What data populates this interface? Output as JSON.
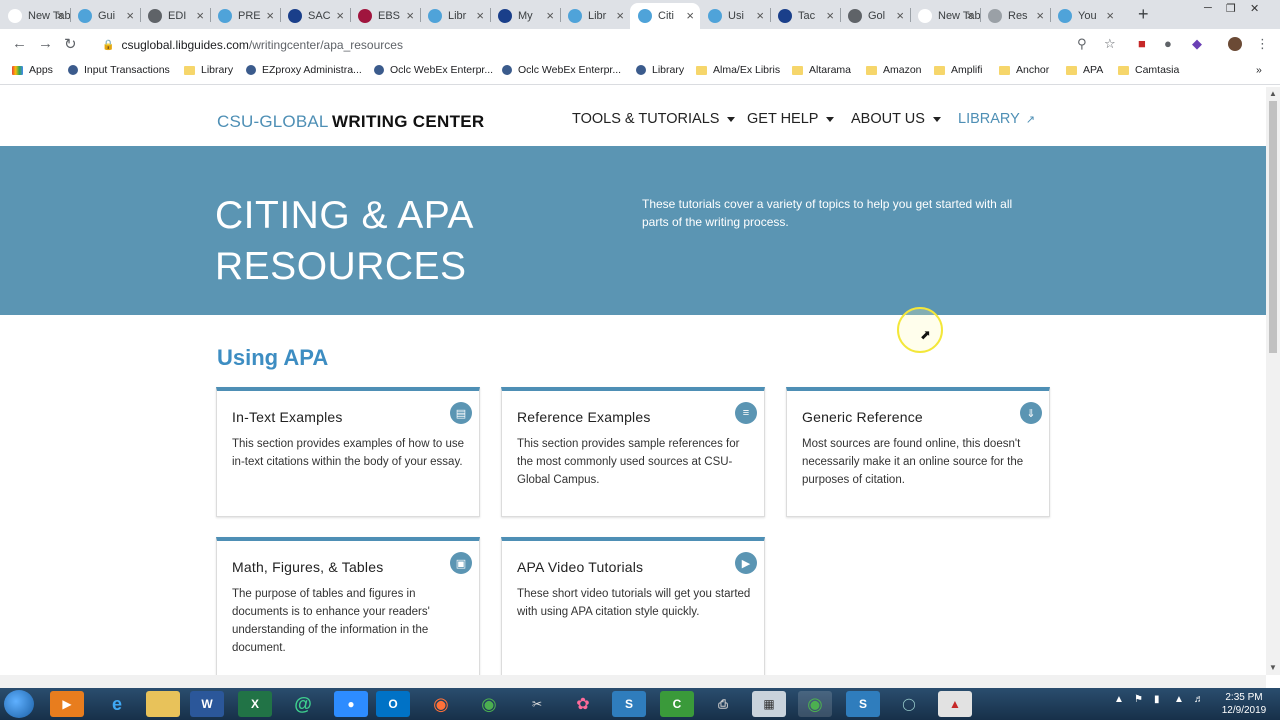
{
  "browser": {
    "tabs": [
      {
        "title": "New Tab",
        "color": "#ffffff"
      },
      {
        "title": "Gui",
        "color": "#4fa3d9"
      },
      {
        "title": "EDI",
        "color": "#5f6368"
      },
      {
        "title": "PRE",
        "color": "#4fa3d9"
      },
      {
        "title": "SAC",
        "color": "#1a3f8a"
      },
      {
        "title": "EBS",
        "color": "#a0153e"
      },
      {
        "title": "Libr",
        "color": "#4fa3d9"
      },
      {
        "title": "My",
        "color": "#1a3f8a"
      },
      {
        "title": "Libr",
        "color": "#4fa3d9"
      },
      {
        "title": "Citi",
        "color": "#4fa3d9"
      },
      {
        "title": "Usi",
        "color": "#4fa3d9"
      },
      {
        "title": "Tac",
        "color": "#1a3f8a"
      },
      {
        "title": "Gol",
        "color": "#5f6368"
      },
      {
        "title": "New Tab",
        "color": "#ffffff"
      },
      {
        "title": "Res",
        "color": "#9aa0a6"
      },
      {
        "title": "You",
        "color": "#4fa3d9"
      }
    ],
    "active_tab_index": 9,
    "url_host": "csuglobal.libguides.com",
    "url_path": "/writingcenter/apa_resources",
    "bookmarks": [
      {
        "label": "Apps",
        "type": "apps"
      },
      {
        "label": "Input Transactions",
        "type": "site"
      },
      {
        "label": "Library",
        "type": "folder"
      },
      {
        "label": "EZproxy Administra...",
        "type": "site"
      },
      {
        "label": "Oclc WebEx Enterpr...",
        "type": "site"
      },
      {
        "label": "Oclc WebEx Enterpr...",
        "type": "site"
      },
      {
        "label": "Library",
        "type": "site"
      },
      {
        "label": "Alma/Ex Libris",
        "type": "folder"
      },
      {
        "label": "Altarama",
        "type": "folder"
      },
      {
        "label": "Amazon",
        "type": "folder"
      },
      {
        "label": "Amplifi",
        "type": "folder"
      },
      {
        "label": "Anchor",
        "type": "folder"
      },
      {
        "label": "APA",
        "type": "folder"
      },
      {
        "label": "Camtasia",
        "type": "folder"
      }
    ]
  },
  "site": {
    "brand_part1": "CSU-GLOBAL",
    "brand_part2": "WRITING CENTER",
    "nav": {
      "tools": "TOOLS & TUTORIALS",
      "help": "GET HELP",
      "about": "ABOUT US",
      "library": "LIBRARY"
    },
    "hero": {
      "title": "CITING & APA RESOURCES",
      "description": "These tutorials cover a variety of topics to help you get started with all parts of the writing process."
    },
    "section_title": "Using APA",
    "cards": [
      {
        "title": "In-Text Examples",
        "text": "This section provides examples of how to use in-text citations within the body of your essay.",
        "icon": "document-icon"
      },
      {
        "title": "Reference Examples",
        "text": "This section provides sample references for the most commonly used sources at CSU-Global Campus.",
        "icon": "list-icon"
      },
      {
        "title": "Generic Reference",
        "text": "Most sources are found online, this doesn't necessarily make it an online source for the purposes of citation.",
        "icon": "download-icon"
      },
      {
        "title": "Math, Figures, & Tables",
        "text": "The purpose of tables and figures in documents is to enhance your readers' understanding of the information in the document.",
        "icon": "image-icon"
      },
      {
        "title": "APA Video Tutorials",
        "text": "These short video tutorials will get you started with using APA citation style quickly.",
        "icon": "play-icon"
      }
    ]
  },
  "taskbar": {
    "time": "2:35 PM",
    "date": "12/9/2019"
  }
}
